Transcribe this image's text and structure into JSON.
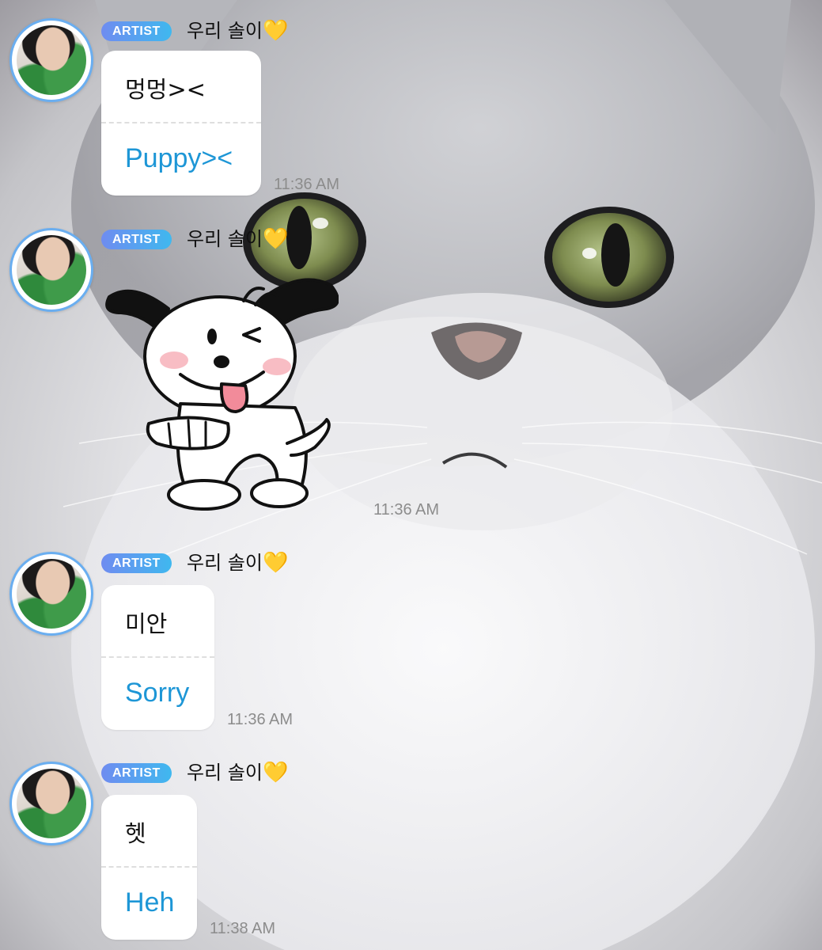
{
  "messages": [
    {
      "badge": "ARTIST",
      "sender": "우리 솔이",
      "sender_emoji": "💛",
      "original": "멍멍><",
      "translation": "Puppy><",
      "time": "11:36 AM"
    },
    {
      "badge": "ARTIST",
      "sender": "우리 솔이",
      "sender_emoji": "💛",
      "sticker": "puppy-sticker",
      "time": "11:36 AM"
    },
    {
      "badge": "ARTIST",
      "sender": "우리 솔이",
      "sender_emoji": "💛",
      "original": "미안",
      "translation": "Sorry",
      "time": "11:36 AM"
    },
    {
      "badge": "ARTIST",
      "sender": "우리 솔이",
      "sender_emoji": "💛",
      "original": "헷",
      "translation": "Heh",
      "time": "11:38 AM"
    }
  ],
  "colors": {
    "badge_start": "#6f8cf0",
    "badge_end": "#3fb8ef",
    "translation_text": "#1d96d6",
    "avatar_ring": "#6aaef0",
    "timestamp": "#8c8c8c"
  }
}
